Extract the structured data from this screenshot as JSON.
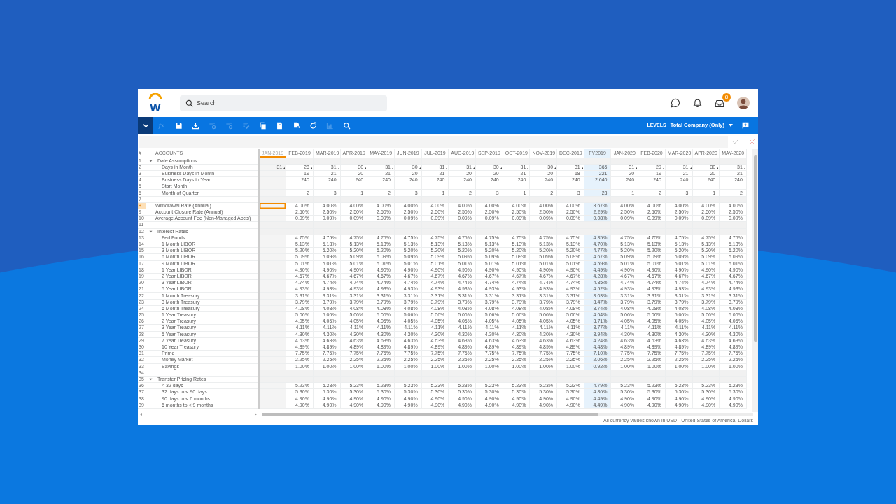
{
  "header": {
    "logo_text": "w",
    "search": {
      "placeholder": "Search"
    },
    "inbox_badge": "8"
  },
  "toolbar": {
    "tools": [
      {
        "kind": "menu",
        "disabled": false
      },
      {
        "kind": "fx",
        "label": "fx",
        "disabled": true
      },
      {
        "kind": "save",
        "disabled": false
      },
      {
        "kind": "download",
        "disabled": false
      },
      {
        "kind": "rows",
        "disabled": true
      },
      {
        "kind": "columns",
        "disabled": true
      },
      {
        "kind": "edit",
        "disabled": true
      },
      {
        "kind": "copy",
        "disabled": false
      },
      {
        "kind": "paste",
        "disabled": false
      },
      {
        "kind": "export",
        "disabled": false
      },
      {
        "kind": "refresh",
        "disabled": false
      },
      {
        "kind": "chart",
        "disabled": true
      },
      {
        "kind": "search",
        "disabled": false
      }
    ],
    "levels_label": "LEVELS",
    "levels_value": "Total Company (Only)"
  },
  "grid": {
    "number_header": "#",
    "label_header": "ACCOUNTS",
    "columns": [
      {
        "label": "JAN-2019",
        "kind": "month",
        "disabled": true,
        "selected": true
      },
      {
        "label": "FEB-2019",
        "kind": "month",
        "disabled": false,
        "selected": false
      },
      {
        "label": "MAR-2019",
        "kind": "month",
        "disabled": false,
        "selected": false
      },
      {
        "label": "APR-2019",
        "kind": "month",
        "disabled": false,
        "selected": false
      },
      {
        "label": "MAY-2019",
        "kind": "month",
        "disabled": false,
        "selected": false
      },
      {
        "label": "JUN-2019",
        "kind": "month",
        "disabled": false,
        "selected": false
      },
      {
        "label": "JUL-2019",
        "kind": "month",
        "disabled": false,
        "selected": false
      },
      {
        "label": "AUG-2019",
        "kind": "month",
        "disabled": false,
        "selected": false
      },
      {
        "label": "SEP-2019",
        "kind": "month",
        "disabled": false,
        "selected": false
      },
      {
        "label": "OCT-2019",
        "kind": "month",
        "disabled": false,
        "selected": false
      },
      {
        "label": "NOV-2019",
        "kind": "month",
        "disabled": false,
        "selected": false
      },
      {
        "label": "DEC-2019",
        "kind": "month",
        "disabled": false,
        "selected": false
      },
      {
        "label": "FY2019",
        "kind": "total",
        "disabled": false,
        "selected": false
      },
      {
        "label": "JAN-2020",
        "kind": "month",
        "disabled": false,
        "selected": false
      },
      {
        "label": "FEB-2020",
        "kind": "month",
        "disabled": false,
        "selected": false
      },
      {
        "label": "MAR-2020",
        "kind": "month",
        "disabled": false,
        "selected": false
      },
      {
        "label": "APR-2020",
        "kind": "month",
        "disabled": false,
        "selected": false
      },
      {
        "label": "MAY-2020",
        "kind": "month",
        "disabled": false,
        "selected": false
      }
    ],
    "rows": [
      {
        "num": "1",
        "kind": "group",
        "label": "Date Assumptions",
        "expanded": true,
        "selected": false,
        "children": [
          {
            "num": "2",
            "kind": "item",
            "label": "Days in Month",
            "marked": true,
            "selected": false,
            "values": [
              "31",
              "28",
              "31",
              "30",
              "31",
              "30",
              "31",
              "31",
              "30",
              "31",
              "30",
              "31",
              "365",
              "31",
              "29",
              "31",
              "30",
              "31"
            ]
          },
          {
            "num": "3",
            "kind": "item",
            "label": "Business Days in Month",
            "selected": false,
            "values": [
              "19",
              "21",
              "20",
              "21",
              "20",
              "21",
              "20",
              "20",
              "21",
              "20",
              "18",
              "221",
              "20",
              "19",
              "21",
              "20",
              "21"
            ]
          },
          {
            "num": "4",
            "kind": "item",
            "label": "Business Days in Year",
            "selected": false,
            "values": [
              "240",
              "240",
              "240",
              "240",
              "240",
              "240",
              "240",
              "240",
              "240",
              "240",
              "240",
              "2,640",
              "240",
              "240",
              "240",
              "240",
              "240"
            ]
          },
          {
            "num": "5",
            "kind": "item",
            "label": "Start Month",
            "selected": false
          },
          {
            "num": "6",
            "kind": "item",
            "label": "Month of Quarter",
            "selected": false,
            "values": [
              "2",
              "3",
              "1",
              "2",
              "3",
              "1",
              "2",
              "3",
              "1",
              "2",
              "3",
              "23",
              "1",
              "2",
              "3",
              "1",
              "2"
            ]
          }
        ]
      },
      {
        "num": "7",
        "kind": "blank",
        "selected": false
      },
      {
        "num": "8",
        "kind": "item",
        "label": "Withdrawal Rate (Annual)",
        "selected": true,
        "values": [
          "4.00%",
          "4.00%",
          "4.00%",
          "4.00%",
          "4.00%",
          "4.00%",
          "4.00%",
          "4.00%",
          "4.00%",
          "4.00%",
          "4.00%",
          "3.67%",
          "4.00%",
          "4.00%",
          "4.00%",
          "4.00%",
          "4.00%"
        ]
      },
      {
        "num": "9",
        "kind": "item",
        "label": "Account Closure Rate (Annual)",
        "selected": false,
        "values": [
          "2.50%",
          "2.50%",
          "2.50%",
          "2.50%",
          "2.50%",
          "2.50%",
          "2.50%",
          "2.50%",
          "2.50%",
          "2.50%",
          "2.50%",
          "2.29%",
          "2.50%",
          "2.50%",
          "2.50%",
          "2.50%",
          "2.50%"
        ]
      },
      {
        "num": "10",
        "kind": "item",
        "label": "Average Account Fee (Non-Managed Accts)",
        "selected": false,
        "values": [
          "0.09%",
          "0.09%",
          "0.09%",
          "0.09%",
          "0.09%",
          "0.09%",
          "0.09%",
          "0.09%",
          "0.09%",
          "0.09%",
          "0.09%",
          "0.08%",
          "0.09%",
          "0.09%",
          "0.09%",
          "0.09%",
          "0.09%"
        ]
      },
      {
        "num": "11",
        "kind": "blank",
        "selected": false
      },
      {
        "num": "12",
        "kind": "group",
        "label": "Interest Rates",
        "expanded": true,
        "selected": false,
        "children": [
          {
            "num": "13",
            "kind": "item",
            "label": "Fed Funds",
            "selected": false,
            "values": [
              "4.75%",
              "4.75%",
              "4.75%",
              "4.75%",
              "4.75%",
              "4.75%",
              "4.75%",
              "4.75%",
              "4.75%",
              "4.75%",
              "4.75%",
              "4.35%",
              "4.75%",
              "4.75%",
              "4.75%",
              "4.75%",
              "4.75%"
            ]
          },
          {
            "num": "14",
            "kind": "item",
            "label": "1 Month LIBOR",
            "selected": false,
            "values": [
              "5.13%",
              "5.13%",
              "5.13%",
              "5.13%",
              "5.13%",
              "5.13%",
              "5.13%",
              "5.13%",
              "5.13%",
              "5.13%",
              "5.13%",
              "4.70%",
              "5.13%",
              "5.13%",
              "5.13%",
              "5.13%",
              "5.13%"
            ]
          },
          {
            "num": "15",
            "kind": "item",
            "label": "3 Month LIBOR",
            "selected": false,
            "values": [
              "5.20%",
              "5.20%",
              "5.20%",
              "5.20%",
              "5.20%",
              "5.20%",
              "5.20%",
              "5.20%",
              "5.20%",
              "5.20%",
              "5.20%",
              "4.77%",
              "5.20%",
              "5.20%",
              "5.20%",
              "5.20%",
              "5.20%"
            ]
          },
          {
            "num": "16",
            "kind": "item",
            "label": "6 Month LIBOR",
            "selected": false,
            "values": [
              "5.09%",
              "5.09%",
              "5.09%",
              "5.09%",
              "5.09%",
              "5.09%",
              "5.09%",
              "5.09%",
              "5.09%",
              "5.09%",
              "5.09%",
              "4.67%",
              "5.09%",
              "5.09%",
              "5.09%",
              "5.09%",
              "5.09%"
            ]
          },
          {
            "num": "17",
            "kind": "item",
            "label": "9 Month LIBOR",
            "selected": false,
            "values": [
              "5.01%",
              "5.01%",
              "5.01%",
              "5.01%",
              "5.01%",
              "5.01%",
              "5.01%",
              "5.01%",
              "5.01%",
              "5.01%",
              "5.01%",
              "4.59%",
              "5.01%",
              "5.01%",
              "5.01%",
              "5.01%",
              "5.01%"
            ]
          },
          {
            "num": "18",
            "kind": "item",
            "label": "1 Year LIBOR",
            "selected": false,
            "values": [
              "4.90%",
              "4.90%",
              "4.90%",
              "4.90%",
              "4.90%",
              "4.90%",
              "4.90%",
              "4.90%",
              "4.90%",
              "4.90%",
              "4.90%",
              "4.49%",
              "4.90%",
              "4.90%",
              "4.90%",
              "4.90%",
              "4.90%"
            ]
          },
          {
            "num": "19",
            "kind": "item",
            "label": "2 Year LIBOR",
            "selected": false,
            "values": [
              "4.67%",
              "4.67%",
              "4.67%",
              "4.67%",
              "4.67%",
              "4.67%",
              "4.67%",
              "4.67%",
              "4.67%",
              "4.67%",
              "4.67%",
              "4.28%",
              "4.67%",
              "4.67%",
              "4.67%",
              "4.67%",
              "4.67%"
            ]
          },
          {
            "num": "20",
            "kind": "item",
            "label": "3 Year LIBOR",
            "selected": false,
            "values": [
              "4.74%",
              "4.74%",
              "4.74%",
              "4.74%",
              "4.74%",
              "4.74%",
              "4.74%",
              "4.74%",
              "4.74%",
              "4.74%",
              "4.74%",
              "4.35%",
              "4.74%",
              "4.74%",
              "4.74%",
              "4.74%",
              "4.74%"
            ]
          },
          {
            "num": "21",
            "kind": "item",
            "label": "5 Year LIBOR",
            "selected": false,
            "values": [
              "4.93%",
              "4.93%",
              "4.93%",
              "4.93%",
              "4.93%",
              "4.93%",
              "4.93%",
              "4.93%",
              "4.93%",
              "4.93%",
              "4.93%",
              "4.52%",
              "4.93%",
              "4.93%",
              "4.93%",
              "4.93%",
              "4.93%"
            ]
          },
          {
            "num": "22",
            "kind": "item",
            "label": "1 Month Treasury",
            "selected": false,
            "values": [
              "3.31%",
              "3.31%",
              "3.31%",
              "3.31%",
              "3.31%",
              "3.31%",
              "3.31%",
              "3.31%",
              "3.31%",
              "3.31%",
              "3.31%",
              "3.03%",
              "3.31%",
              "3.31%",
              "3.31%",
              "3.31%",
              "3.31%"
            ]
          },
          {
            "num": "23",
            "kind": "item",
            "label": "3 Month Treasury",
            "selected": false,
            "values": [
              "3.79%",
              "3.79%",
              "3.79%",
              "3.79%",
              "3.79%",
              "3.79%",
              "3.79%",
              "3.79%",
              "3.79%",
              "3.79%",
              "3.79%",
              "3.47%",
              "3.79%",
              "3.79%",
              "3.79%",
              "3.79%",
              "3.79%"
            ]
          },
          {
            "num": "24",
            "kind": "item",
            "label": "6 Month Treasury",
            "selected": false,
            "values": [
              "4.08%",
              "4.08%",
              "4.08%",
              "4.08%",
              "4.08%",
              "4.08%",
              "4.08%",
              "4.08%",
              "4.08%",
              "4.08%",
              "4.08%",
              "3.74%",
              "4.08%",
              "4.08%",
              "4.08%",
              "4.08%",
              "4.08%"
            ]
          },
          {
            "num": "25",
            "kind": "item",
            "label": "1 Year Treasury",
            "selected": false,
            "values": [
              "5.06%",
              "5.06%",
              "5.06%",
              "5.06%",
              "5.06%",
              "5.06%",
              "5.06%",
              "5.06%",
              "5.06%",
              "5.06%",
              "5.06%",
              "4.64%",
              "5.06%",
              "5.06%",
              "5.06%",
              "5.06%",
              "5.06%"
            ]
          },
          {
            "num": "26",
            "kind": "item",
            "label": "2 Year Treasury",
            "selected": false,
            "values": [
              "4.05%",
              "4.05%",
              "4.05%",
              "4.05%",
              "4.05%",
              "4.05%",
              "4.05%",
              "4.05%",
              "4.05%",
              "4.05%",
              "4.05%",
              "3.71%",
              "4.05%",
              "4.05%",
              "4.05%",
              "4.05%",
              "4.05%"
            ]
          },
          {
            "num": "27",
            "kind": "item",
            "label": "3 Year Treasury",
            "selected": false,
            "values": [
              "4.11%",
              "4.11%",
              "4.11%",
              "4.11%",
              "4.11%",
              "4.11%",
              "4.11%",
              "4.11%",
              "4.11%",
              "4.11%",
              "4.11%",
              "3.77%",
              "4.11%",
              "4.11%",
              "4.11%",
              "4.11%",
              "4.11%"
            ]
          },
          {
            "num": "28",
            "kind": "item",
            "label": "5 Year Treasury",
            "selected": false,
            "values": [
              "4.30%",
              "4.30%",
              "4.30%",
              "4.30%",
              "4.30%",
              "4.30%",
              "4.30%",
              "4.30%",
              "4.30%",
              "4.30%",
              "4.30%",
              "3.94%",
              "4.30%",
              "4.30%",
              "4.30%",
              "4.30%",
              "4.30%"
            ]
          },
          {
            "num": "29",
            "kind": "item",
            "label": "7 Year Treasury",
            "selected": false,
            "values": [
              "4.63%",
              "4.63%",
              "4.63%",
              "4.63%",
              "4.63%",
              "4.63%",
              "4.63%",
              "4.63%",
              "4.63%",
              "4.63%",
              "4.63%",
              "4.24%",
              "4.63%",
              "4.63%",
              "4.63%",
              "4.63%",
              "4.63%"
            ]
          },
          {
            "num": "30",
            "kind": "item",
            "label": "10 Year Treasury",
            "selected": false,
            "values": [
              "4.89%",
              "4.89%",
              "4.89%",
              "4.89%",
              "4.89%",
              "4.89%",
              "4.89%",
              "4.89%",
              "4.89%",
              "4.89%",
              "4.89%",
              "4.48%",
              "4.89%",
              "4.89%",
              "4.89%",
              "4.89%",
              "4.89%"
            ]
          },
          {
            "num": "31",
            "kind": "item",
            "label": "Prime",
            "selected": false,
            "values": [
              "7.75%",
              "7.75%",
              "7.75%",
              "7.75%",
              "7.75%",
              "7.75%",
              "7.75%",
              "7.75%",
              "7.75%",
              "7.75%",
              "7.75%",
              "7.10%",
              "7.75%",
              "7.75%",
              "7.75%",
              "7.75%",
              "7.75%"
            ]
          },
          {
            "num": "32",
            "kind": "item",
            "label": "Money Market",
            "selected": false,
            "values": [
              "2.25%",
              "2.25%",
              "2.25%",
              "2.25%",
              "2.25%",
              "2.25%",
              "2.25%",
              "2.25%",
              "2.25%",
              "2.25%",
              "2.25%",
              "2.06%",
              "2.25%",
              "2.25%",
              "2.25%",
              "2.25%",
              "2.25%"
            ]
          },
          {
            "num": "33",
            "kind": "item",
            "label": "Savings",
            "selected": false,
            "values": [
              "1.00%",
              "1.00%",
              "1.00%",
              "1.00%",
              "1.00%",
              "1.00%",
              "1.00%",
              "1.00%",
              "1.00%",
              "1.00%",
              "1.00%",
              "0.92%",
              "1.00%",
              "1.00%",
              "1.00%",
              "1.00%",
              "1.00%"
            ]
          }
        ]
      },
      {
        "num": "34",
        "kind": "blank",
        "selected": false
      },
      {
        "num": "35",
        "kind": "group",
        "label": "Transfer Pricing Rates",
        "expanded": true,
        "selected": false,
        "children": [
          {
            "num": "36",
            "kind": "item",
            "label": "< 32 days",
            "selected": false,
            "values": [
              "5.23%",
              "5.23%",
              "5.23%",
              "5.23%",
              "5.23%",
              "5.23%",
              "5.23%",
              "5.23%",
              "5.23%",
              "5.23%",
              "5.23%",
              "4.79%",
              "5.23%",
              "5.23%",
              "5.23%",
              "5.23%",
              "5.23%"
            ]
          },
          {
            "num": "37",
            "kind": "item",
            "label": "32 days to < 90 days",
            "selected": false,
            "values": [
              "5.30%",
              "5.30%",
              "5.30%",
              "5.30%",
              "5.30%",
              "5.30%",
              "5.30%",
              "5.30%",
              "5.30%",
              "5.30%",
              "5.30%",
              "4.86%",
              "5.30%",
              "5.30%",
              "5.30%",
              "5.30%",
              "5.30%"
            ]
          },
          {
            "num": "38",
            "kind": "item",
            "label": "90 days to < 6 months",
            "selected": false,
            "values": [
              "4.90%",
              "4.90%",
              "4.90%",
              "4.90%",
              "4.90%",
              "4.90%",
              "4.90%",
              "4.90%",
              "4.90%",
              "4.90%",
              "4.90%",
              "4.49%",
              "4.90%",
              "4.90%",
              "4.90%",
              "4.90%",
              "4.90%"
            ]
          },
          {
            "num": "39",
            "kind": "item",
            "label": "6 months to < 9 months",
            "selected": false,
            "values": [
              "4.90%",
              "4.90%",
              "4.90%",
              "4.90%",
              "4.90%",
              "4.90%",
              "4.90%",
              "4.90%",
              "4.90%",
              "4.90%",
              "4.90%",
              "4.49%",
              "4.90%",
              "4.90%",
              "4.90%",
              "4.90%",
              "4.90%"
            ]
          }
        ]
      }
    ]
  },
  "footer": "All currency values shown in USD - United States of America, Dollars"
}
